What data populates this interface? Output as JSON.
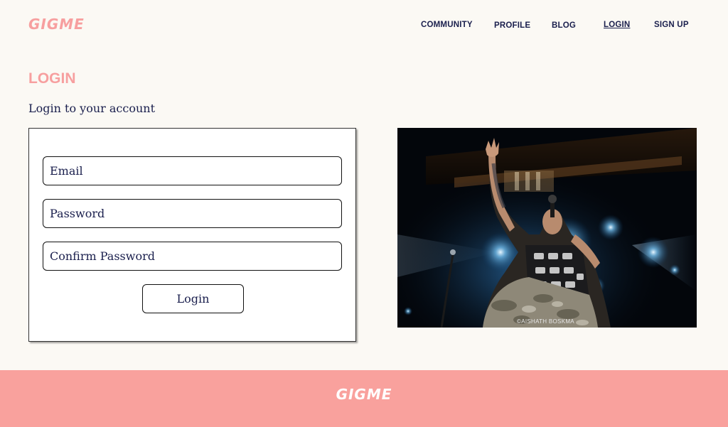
{
  "header": {
    "logo": "GIGME",
    "nav": [
      {
        "label": "COMMUNITY"
      },
      {
        "label": "PROFILE"
      },
      {
        "label": "BLOG"
      },
      {
        "label": "LOGIN",
        "active": true
      },
      {
        "label": "SIGN UP"
      }
    ]
  },
  "main": {
    "title": "LOGIN",
    "subtitle": "Login to your account",
    "form": {
      "email_placeholder": "Email",
      "password_placeholder": "Password",
      "confirm_placeholder": "Confirm Password",
      "submit_label": "Login"
    },
    "photo": {
      "credit": "©AISHATH BOSKMA"
    }
  },
  "footer": {
    "logo": "GIGME"
  },
  "colors": {
    "brand_pink": "#f79f9f",
    "footer_pink": "#f9a19d",
    "navy_text": "#1a1f4d",
    "page_background": "#fbf9f4"
  }
}
